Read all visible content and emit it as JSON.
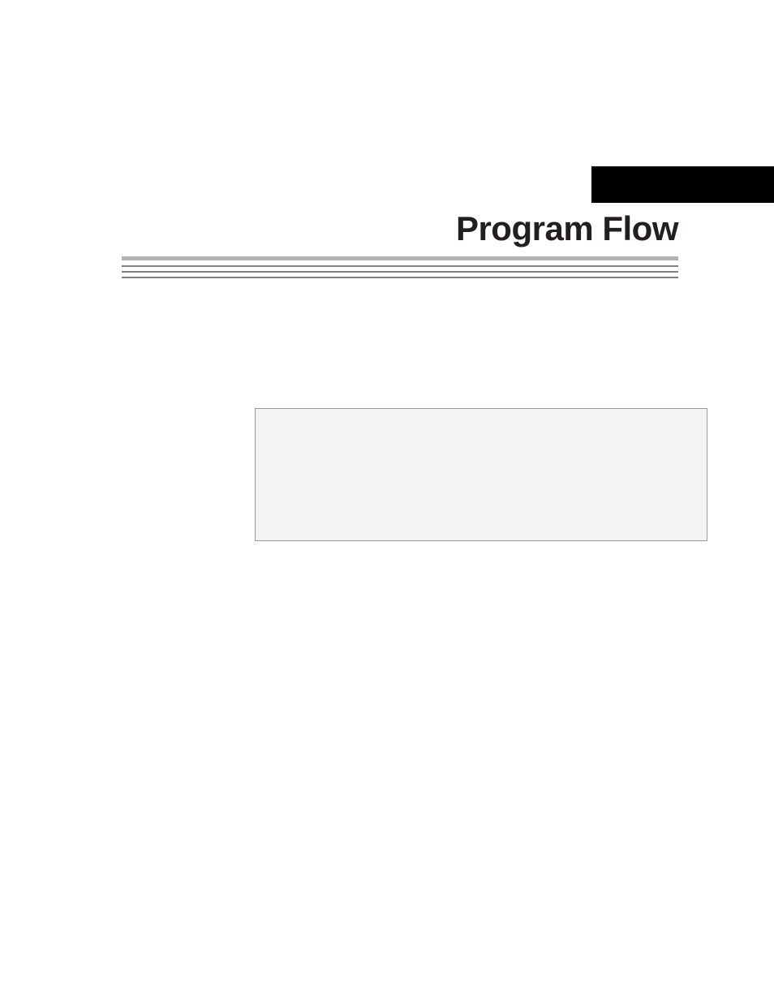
{
  "header": {
    "tab": "",
    "title": "Program Flow"
  },
  "body": {
    "intro": ""
  },
  "box": {
    "title": "",
    "items": [
      "",
      "",
      "",
      ""
    ]
  }
}
